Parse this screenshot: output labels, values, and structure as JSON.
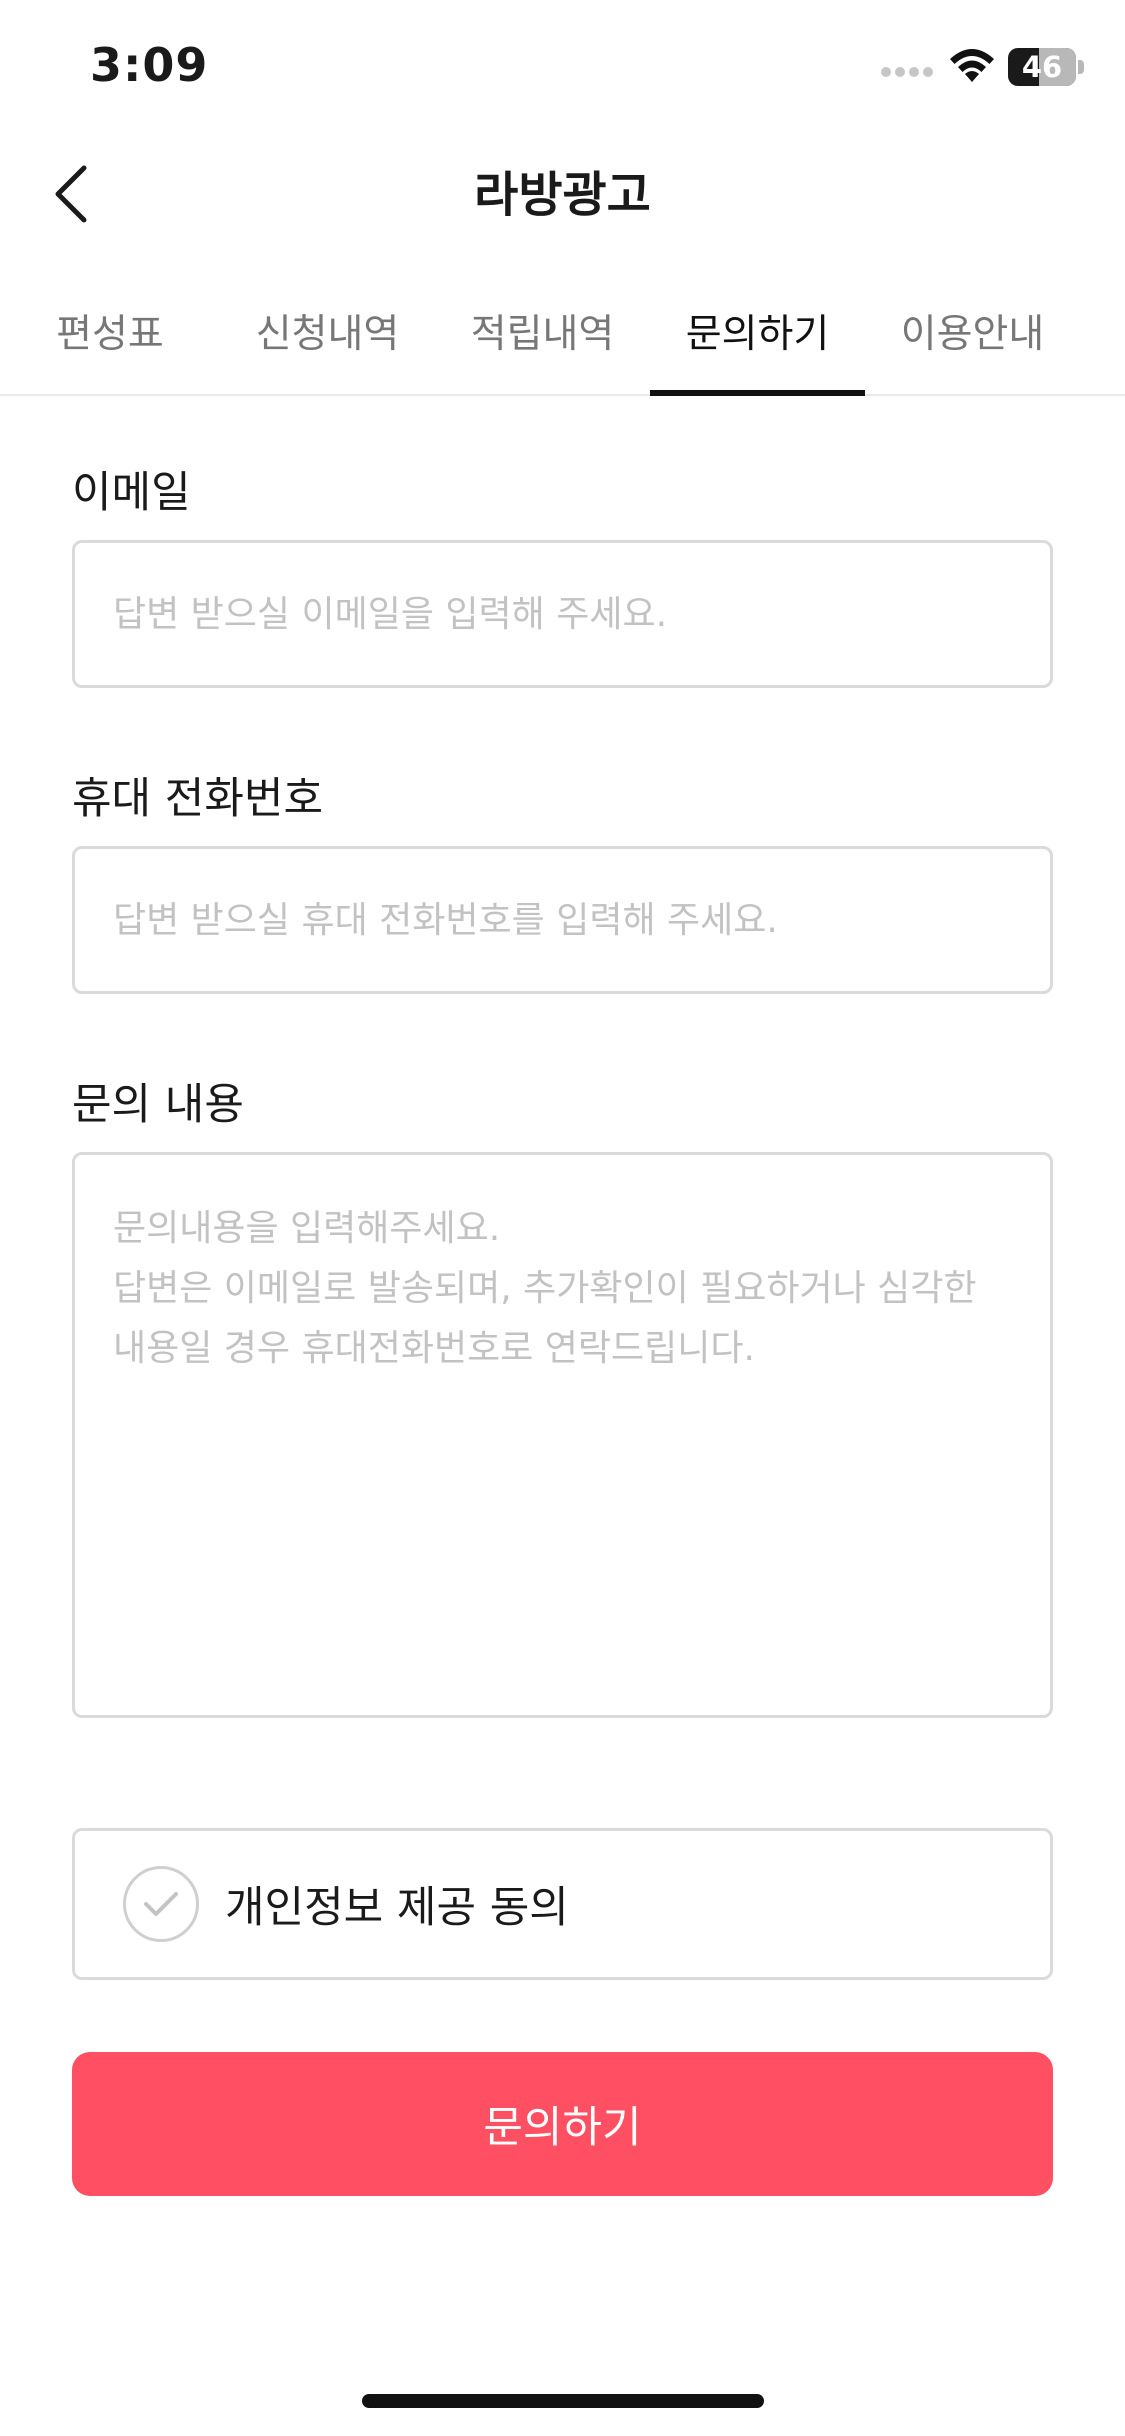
{
  "status_bar": {
    "time": "3:09",
    "battery_level": "46",
    "battery_fraction": 0.46
  },
  "header": {
    "title": "라방광고"
  },
  "tabs": [
    {
      "label": "편성표",
      "active": false
    },
    {
      "label": "신청내역",
      "active": false
    },
    {
      "label": "적립내역",
      "active": false
    },
    {
      "label": "문의하기",
      "active": true
    },
    {
      "label": "이용안내",
      "active": false
    }
  ],
  "form": {
    "email": {
      "label": "이메일",
      "value": "",
      "placeholder": "답변 받으실 이메일을 입력해 주세요."
    },
    "phone": {
      "label": "휴대 전화번호",
      "value": "",
      "placeholder": "답변 받으실 휴대 전화번호를 입력해 주세요."
    },
    "content": {
      "label": "문의 내용",
      "value": "",
      "placeholder": "문의내용을 입력해주세요.\n답변은 이메일로 발송되며, 추가확인이 필요하거나 심각한\n내용일 경우 휴대전화번호로 연락드립니다."
    },
    "consent": {
      "label": "개인정보 제공 동의",
      "checked": false
    },
    "submit_label": "문의하기"
  },
  "colors": {
    "accent": "#ff5063",
    "border": "#dadada",
    "placeholder": "#c2c2c2",
    "active_tab": "#111111"
  }
}
